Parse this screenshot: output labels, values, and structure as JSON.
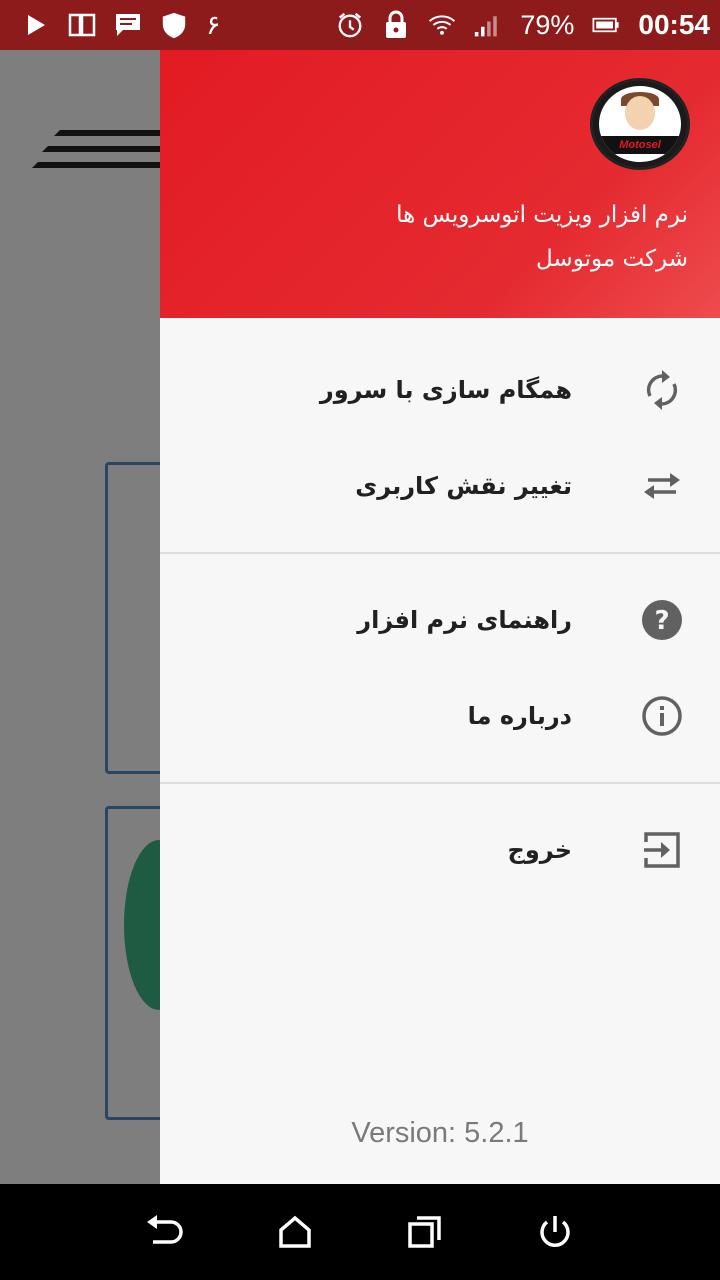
{
  "status_bar": {
    "battery_percent": "79%",
    "time": "00:54",
    "extra_glyph": "۶",
    "icons": [
      "play-icon",
      "sim-icon",
      "message-icon",
      "shield-icon",
      "alarm-icon",
      "lock-icon",
      "wifi-icon",
      "signal-icon",
      "battery-icon"
    ]
  },
  "drawer": {
    "header": {
      "line1": "نرم افزار ویزیت اتوسرویس ها",
      "line2": "شرکت موتوسل",
      "logo_text": "Motosel"
    },
    "menu": [
      {
        "label": "همگام سازی با سرور",
        "icon": "sync-icon"
      },
      {
        "label": "تغییر نقش کاربری",
        "icon": "swap-arrows-icon"
      },
      {
        "label": "راهنمای نرم افزار",
        "icon": "help-icon"
      },
      {
        "label": "درباره ما",
        "icon": "info-icon"
      },
      {
        "label": "خروج",
        "icon": "exit-icon"
      }
    ],
    "version": "Version: 5.2.1"
  },
  "nav_bar": {
    "icons": [
      "back-icon",
      "home-icon",
      "recents-icon",
      "power-icon"
    ]
  },
  "colors": {
    "status_bar": "#8e1b1b",
    "header_red": "#e31b23",
    "drawer_bg": "#f7f7f7",
    "icon_gray": "#616161"
  }
}
